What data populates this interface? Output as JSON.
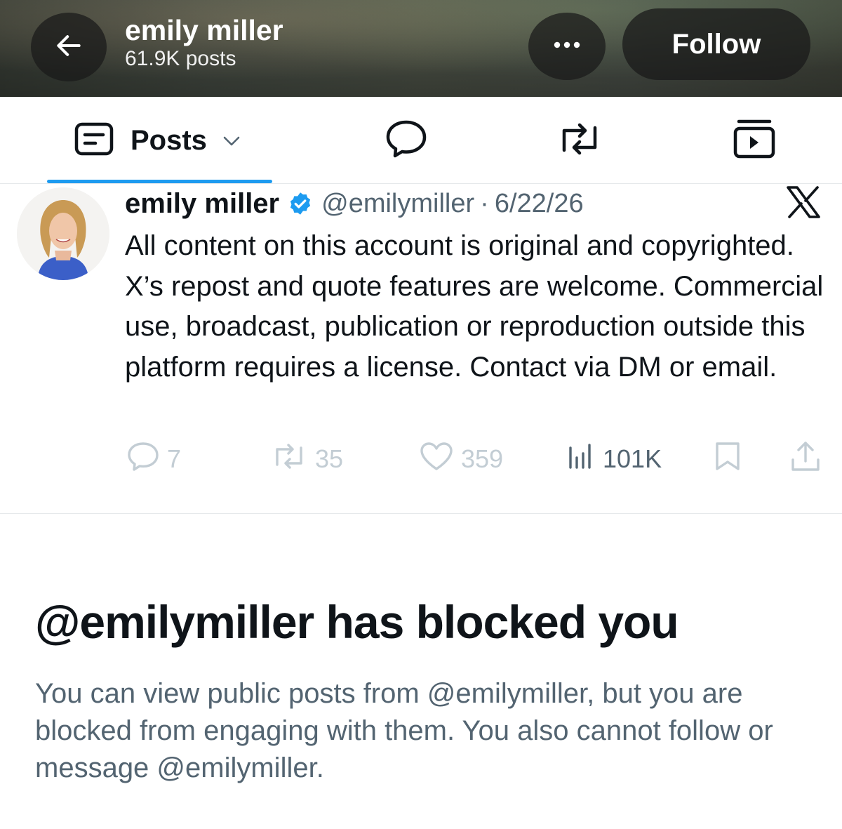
{
  "header": {
    "name": "emily miller",
    "post_count": "61.9K posts",
    "follow_label": "Follow",
    "back_icon": "arrow-left-icon",
    "more_icon": "more-horizontal-icon"
  },
  "tabs": {
    "posts_label": "Posts",
    "active_color": "#1d9bf0"
  },
  "post": {
    "name": "emily miller",
    "handle": "@emilymiller",
    "separator": "·",
    "date": "6/22/26",
    "text": "All content on this account is original and copyrighted. X’s repost and quote features are welcome. Commercial use, broadcast, publication or reproduction outside this platform requires a license. Contact via DM or email.",
    "replies": "7",
    "reposts": "35",
    "likes": "359",
    "views": "101K"
  },
  "blocked": {
    "title": "@emilymiller has blocked you",
    "description": "You can view public posts from @emilymiller, but you are blocked from engaging with them. You also cannot follow or message @emilymiller."
  },
  "colors": {
    "verified": "#1d9bf0",
    "text_primary": "#0f1419",
    "text_secondary": "#536471",
    "disabled": "#c3cdd4"
  }
}
